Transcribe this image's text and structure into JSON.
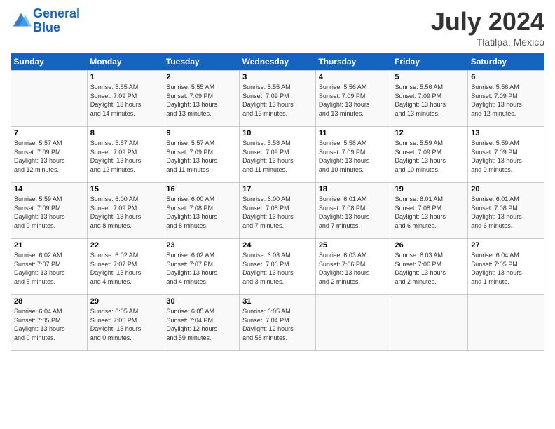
{
  "header": {
    "logo_line1": "General",
    "logo_line2": "Blue",
    "month": "July 2024",
    "location": "Tlatilpa, Mexico"
  },
  "days_of_week": [
    "Sunday",
    "Monday",
    "Tuesday",
    "Wednesday",
    "Thursday",
    "Friday",
    "Saturday"
  ],
  "weeks": [
    [
      {
        "num": "",
        "sunrise": "",
        "sunset": "",
        "daylight": ""
      },
      {
        "num": "1",
        "sunrise": "Sunrise: 5:55 AM",
        "sunset": "Sunset: 7:09 PM",
        "daylight": "Daylight: 13 hours and 14 minutes."
      },
      {
        "num": "2",
        "sunrise": "Sunrise: 5:55 AM",
        "sunset": "Sunset: 7:09 PM",
        "daylight": "Daylight: 13 hours and 13 minutes."
      },
      {
        "num": "3",
        "sunrise": "Sunrise: 5:55 AM",
        "sunset": "Sunset: 7:09 PM",
        "daylight": "Daylight: 13 hours and 13 minutes."
      },
      {
        "num": "4",
        "sunrise": "Sunrise: 5:56 AM",
        "sunset": "Sunset: 7:09 PM",
        "daylight": "Daylight: 13 hours and 13 minutes."
      },
      {
        "num": "5",
        "sunrise": "Sunrise: 5:56 AM",
        "sunset": "Sunset: 7:09 PM",
        "daylight": "Daylight: 13 hours and 13 minutes."
      },
      {
        "num": "6",
        "sunrise": "Sunrise: 5:56 AM",
        "sunset": "Sunset: 7:09 PM",
        "daylight": "Daylight: 13 hours and 12 minutes."
      }
    ],
    [
      {
        "num": "7",
        "sunrise": "Sunrise: 5:57 AM",
        "sunset": "Sunset: 7:09 PM",
        "daylight": "Daylight: 13 hours and 12 minutes."
      },
      {
        "num": "8",
        "sunrise": "Sunrise: 5:57 AM",
        "sunset": "Sunset: 7:09 PM",
        "daylight": "Daylight: 13 hours and 12 minutes."
      },
      {
        "num": "9",
        "sunrise": "Sunrise: 5:57 AM",
        "sunset": "Sunset: 7:09 PM",
        "daylight": "Daylight: 13 hours and 11 minutes."
      },
      {
        "num": "10",
        "sunrise": "Sunrise: 5:58 AM",
        "sunset": "Sunset: 7:09 PM",
        "daylight": "Daylight: 13 hours and 11 minutes."
      },
      {
        "num": "11",
        "sunrise": "Sunrise: 5:58 AM",
        "sunset": "Sunset: 7:09 PM",
        "daylight": "Daylight: 13 hours and 10 minutes."
      },
      {
        "num": "12",
        "sunrise": "Sunrise: 5:59 AM",
        "sunset": "Sunset: 7:09 PM",
        "daylight": "Daylight: 13 hours and 10 minutes."
      },
      {
        "num": "13",
        "sunrise": "Sunrise: 5:59 AM",
        "sunset": "Sunset: 7:09 PM",
        "daylight": "Daylight: 13 hours and 9 minutes."
      }
    ],
    [
      {
        "num": "14",
        "sunrise": "Sunrise: 5:59 AM",
        "sunset": "Sunset: 7:09 PM",
        "daylight": "Daylight: 13 hours and 9 minutes."
      },
      {
        "num": "15",
        "sunrise": "Sunrise: 6:00 AM",
        "sunset": "Sunset: 7:09 PM",
        "daylight": "Daylight: 13 hours and 8 minutes."
      },
      {
        "num": "16",
        "sunrise": "Sunrise: 6:00 AM",
        "sunset": "Sunset: 7:08 PM",
        "daylight": "Daylight: 13 hours and 8 minutes."
      },
      {
        "num": "17",
        "sunrise": "Sunrise: 6:00 AM",
        "sunset": "Sunset: 7:08 PM",
        "daylight": "Daylight: 13 hours and 7 minutes."
      },
      {
        "num": "18",
        "sunrise": "Sunrise: 6:01 AM",
        "sunset": "Sunset: 7:08 PM",
        "daylight": "Daylight: 13 hours and 7 minutes."
      },
      {
        "num": "19",
        "sunrise": "Sunrise: 6:01 AM",
        "sunset": "Sunset: 7:08 PM",
        "daylight": "Daylight: 13 hours and 6 minutes."
      },
      {
        "num": "20",
        "sunrise": "Sunrise: 6:01 AM",
        "sunset": "Sunset: 7:08 PM",
        "daylight": "Daylight: 13 hours and 6 minutes."
      }
    ],
    [
      {
        "num": "21",
        "sunrise": "Sunrise: 6:02 AM",
        "sunset": "Sunset: 7:07 PM",
        "daylight": "Daylight: 13 hours and 5 minutes."
      },
      {
        "num": "22",
        "sunrise": "Sunrise: 6:02 AM",
        "sunset": "Sunset: 7:07 PM",
        "daylight": "Daylight: 13 hours and 4 minutes."
      },
      {
        "num": "23",
        "sunrise": "Sunrise: 6:02 AM",
        "sunset": "Sunset: 7:07 PM",
        "daylight": "Daylight: 13 hours and 4 minutes."
      },
      {
        "num": "24",
        "sunrise": "Sunrise: 6:03 AM",
        "sunset": "Sunset: 7:06 PM",
        "daylight": "Daylight: 13 hours and 3 minutes."
      },
      {
        "num": "25",
        "sunrise": "Sunrise: 6:03 AM",
        "sunset": "Sunset: 7:06 PM",
        "daylight": "Daylight: 13 hours and 2 minutes."
      },
      {
        "num": "26",
        "sunrise": "Sunrise: 6:03 AM",
        "sunset": "Sunset: 7:06 PM",
        "daylight": "Daylight: 13 hours and 2 minutes."
      },
      {
        "num": "27",
        "sunrise": "Sunrise: 6:04 AM",
        "sunset": "Sunset: 7:05 PM",
        "daylight": "Daylight: 13 hours and 1 minute."
      }
    ],
    [
      {
        "num": "28",
        "sunrise": "Sunrise: 6:04 AM",
        "sunset": "Sunset: 7:05 PM",
        "daylight": "Daylight: 13 hours and 0 minutes."
      },
      {
        "num": "29",
        "sunrise": "Sunrise: 6:05 AM",
        "sunset": "Sunset: 7:05 PM",
        "daylight": "Daylight: 13 hours and 0 minutes."
      },
      {
        "num": "30",
        "sunrise": "Sunrise: 6:05 AM",
        "sunset": "Sunset: 7:04 PM",
        "daylight": "Daylight: 12 hours and 59 minutes."
      },
      {
        "num": "31",
        "sunrise": "Sunrise: 6:05 AM",
        "sunset": "Sunset: 7:04 PM",
        "daylight": "Daylight: 12 hours and 58 minutes."
      },
      {
        "num": "",
        "sunrise": "",
        "sunset": "",
        "daylight": ""
      },
      {
        "num": "",
        "sunrise": "",
        "sunset": "",
        "daylight": ""
      },
      {
        "num": "",
        "sunrise": "",
        "sunset": "",
        "daylight": ""
      }
    ]
  ]
}
